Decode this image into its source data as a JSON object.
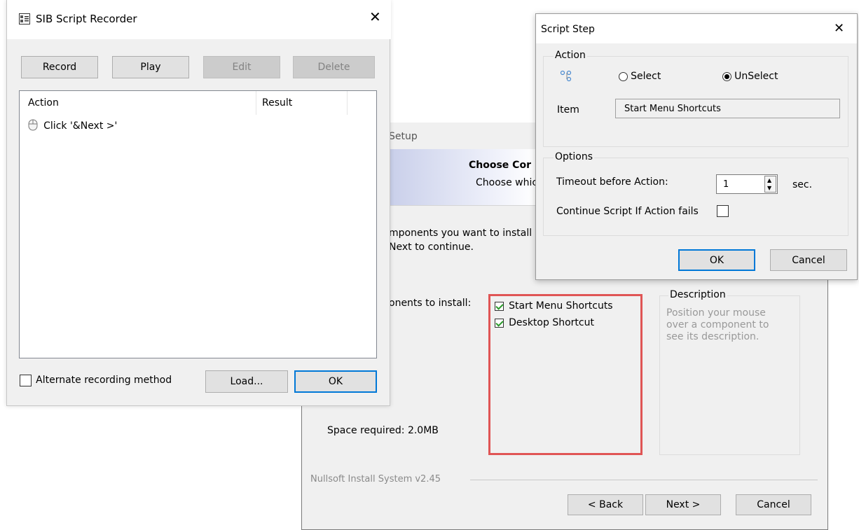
{
  "recorder": {
    "title": "SIB Script Recorder",
    "buttons": {
      "record": "Record",
      "play": "Play",
      "edit": "Edit",
      "delete": "Delete",
      "load": "Load...",
      "ok": "OK"
    },
    "columns": {
      "action": "Action",
      "result": "Result"
    },
    "rows": [
      {
        "action": "Click '&Next >'",
        "result": ""
      }
    ],
    "alt_method_label": "Alternate recording method",
    "alt_method_checked": false
  },
  "setup": {
    "title_partial": "Setup",
    "header_title": "Choose Cor",
    "header_subtitle": "Choose whic",
    "intro_line1": "mponents you want to install",
    "intro_line2": "Next to continue.",
    "components_label": "onents to install:",
    "components": [
      {
        "label": "Start Menu Shortcuts",
        "checked": true
      },
      {
        "label": "Desktop Shortcut",
        "checked": true
      }
    ],
    "description_title": "Description",
    "description_text": "Position your mouse over a component to see its description.",
    "space_required": "Space required: 2.0MB",
    "branding": "Nullsoft Install System v2.45",
    "buttons": {
      "back": "< Back",
      "next": "Next >",
      "cancel": "Cancel"
    }
  },
  "step": {
    "title": "Script Step",
    "action_group": "Action",
    "select_label": "Select",
    "unselect_label": "UnSelect",
    "selected_option": "UnSelect",
    "item_label": "Item",
    "item_value": "Start Menu Shortcuts",
    "options_group": "Options",
    "timeout_label": "Timeout before Action:",
    "timeout_value": "1",
    "timeout_unit": "sec.",
    "continue_label": "Continue Script If Action fails",
    "continue_checked": false,
    "buttons": {
      "ok": "OK",
      "cancel": "Cancel"
    }
  },
  "colors": {
    "accent": "#0078d7",
    "highlight_box": "#e05555",
    "check": "#2a9a2a"
  }
}
